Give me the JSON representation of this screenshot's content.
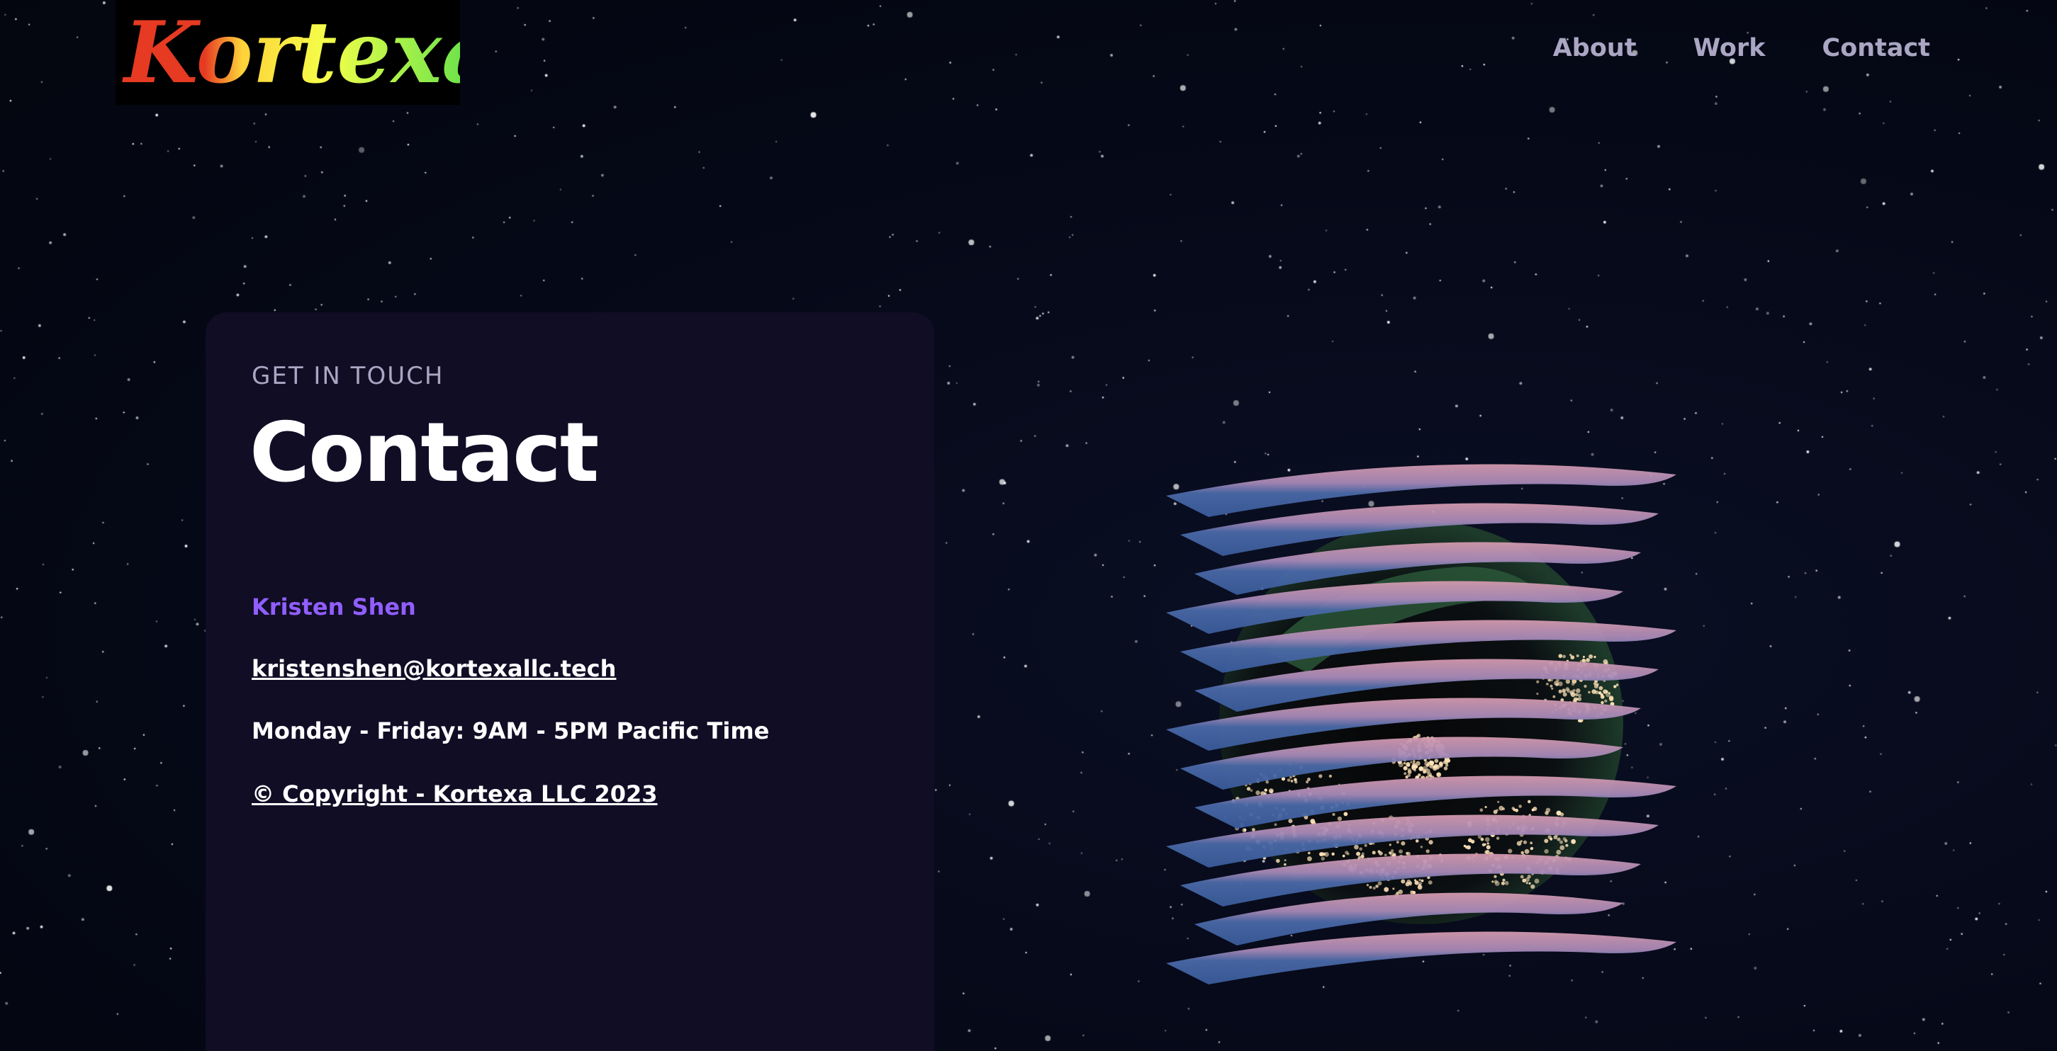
{
  "header": {
    "logo_text": "Kortexa",
    "nav": [
      {
        "label": "About"
      },
      {
        "label": "Work"
      },
      {
        "label": "Contact"
      }
    ]
  },
  "contact": {
    "eyebrow": "GET IN TOUCH",
    "title": "Contact",
    "name": "Kristen Shen",
    "email": "kristenshen@kortexallc.tech",
    "hours": "Monday - Friday: 9AM - 5PM Pacific Time",
    "copyright": "© Copyright - Kortexa LLC 2023"
  },
  "colors": {
    "background": "#050816",
    "card": "#100d25",
    "accent": "#915eff",
    "muted": "#aaa6c3"
  }
}
